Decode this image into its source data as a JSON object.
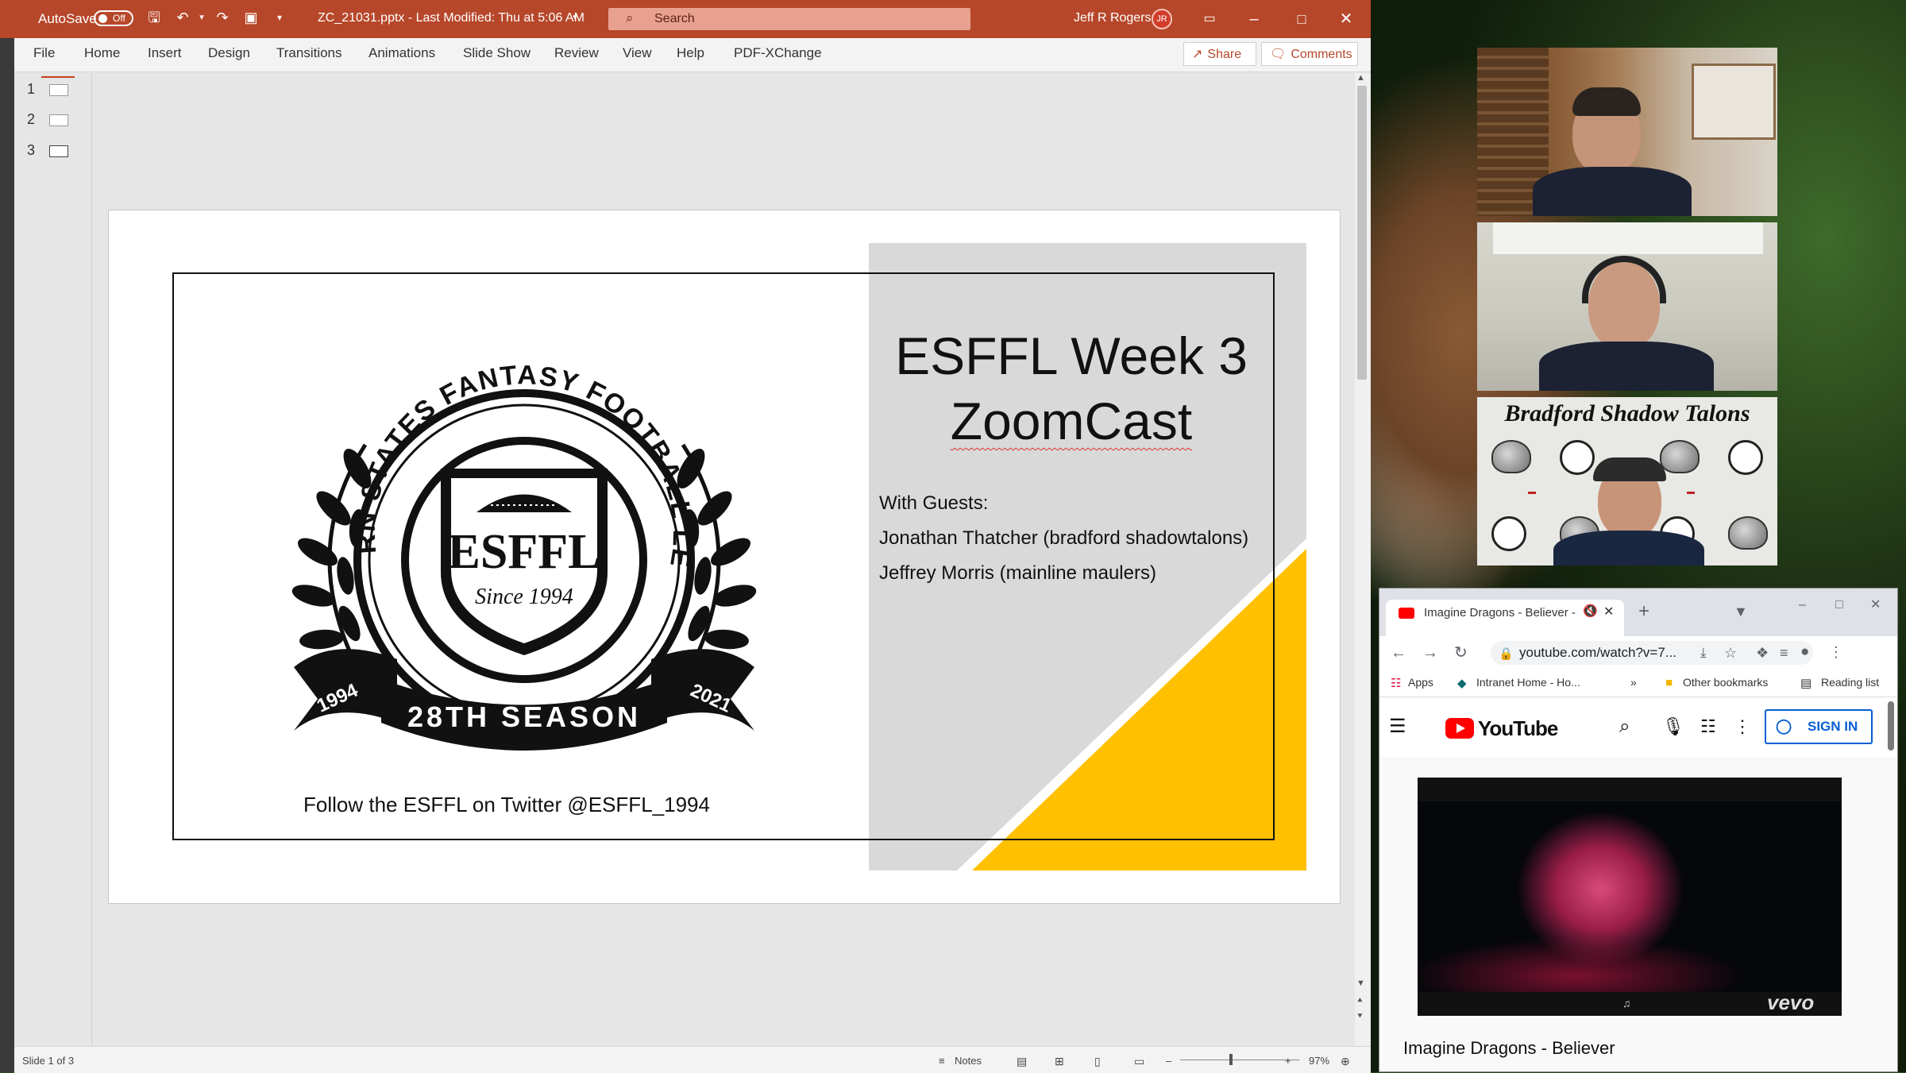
{
  "powerpoint": {
    "autosave_label": "AutoSave",
    "autosave_state": "Off",
    "file_title": "ZC_21031.pptx  -  Last Modified: Thu at 5:06 AM",
    "search_placeholder": "Search",
    "user_name": "Jeff R Rogers",
    "user_initials": "JR",
    "ribbon_tabs": [
      "File",
      "Home",
      "Insert",
      "Design",
      "Transitions",
      "Animations",
      "Slide Show",
      "Review",
      "View",
      "Help",
      "PDF-XChange"
    ],
    "share_label": "Share",
    "comments_label": "Comments",
    "slide_numbers": [
      "1",
      "2",
      "3"
    ],
    "status": {
      "slide_counter": "Slide 1 of 3",
      "notes_label": "Notes",
      "zoom": "97%"
    }
  },
  "slide": {
    "title_line1": "ESFFL Week 3",
    "title_line2": "ZoomCast",
    "guests_heading": "With Guests:",
    "guests": [
      "Jonathan Thatcher (bradford shadowtalons)",
      "Jeffrey Morris (mainline maulers)"
    ],
    "footer": "Follow the ESFFL on Twitter @ESFFL_1994",
    "logo": {
      "arc_text": "EASTERN STATES FANTASY FOOTBALL LEAGUE",
      "shield_text": "ESFFL",
      "since_text": "Since 1994",
      "banner_text": "28TH SEASON",
      "year_left": "1994",
      "year_right": "2021"
    },
    "accent_color": "#ffc000"
  },
  "zoom": {
    "tile3_title": "Bradford Shadow Talons"
  },
  "chrome": {
    "tab_title": "Imagine Dragons - Believer -",
    "url": "youtube.com/watch?v=7...",
    "bookmarks": {
      "apps": "Apps",
      "intranet": "Intranet Home - Ho...",
      "more": "»",
      "other": "Other bookmarks",
      "reading": "Reading list"
    },
    "youtube_logo": "YouTube",
    "sign_in": "SIGN IN",
    "video_brand": "vevo",
    "video_title": "Imagine Dragons - Believer"
  }
}
